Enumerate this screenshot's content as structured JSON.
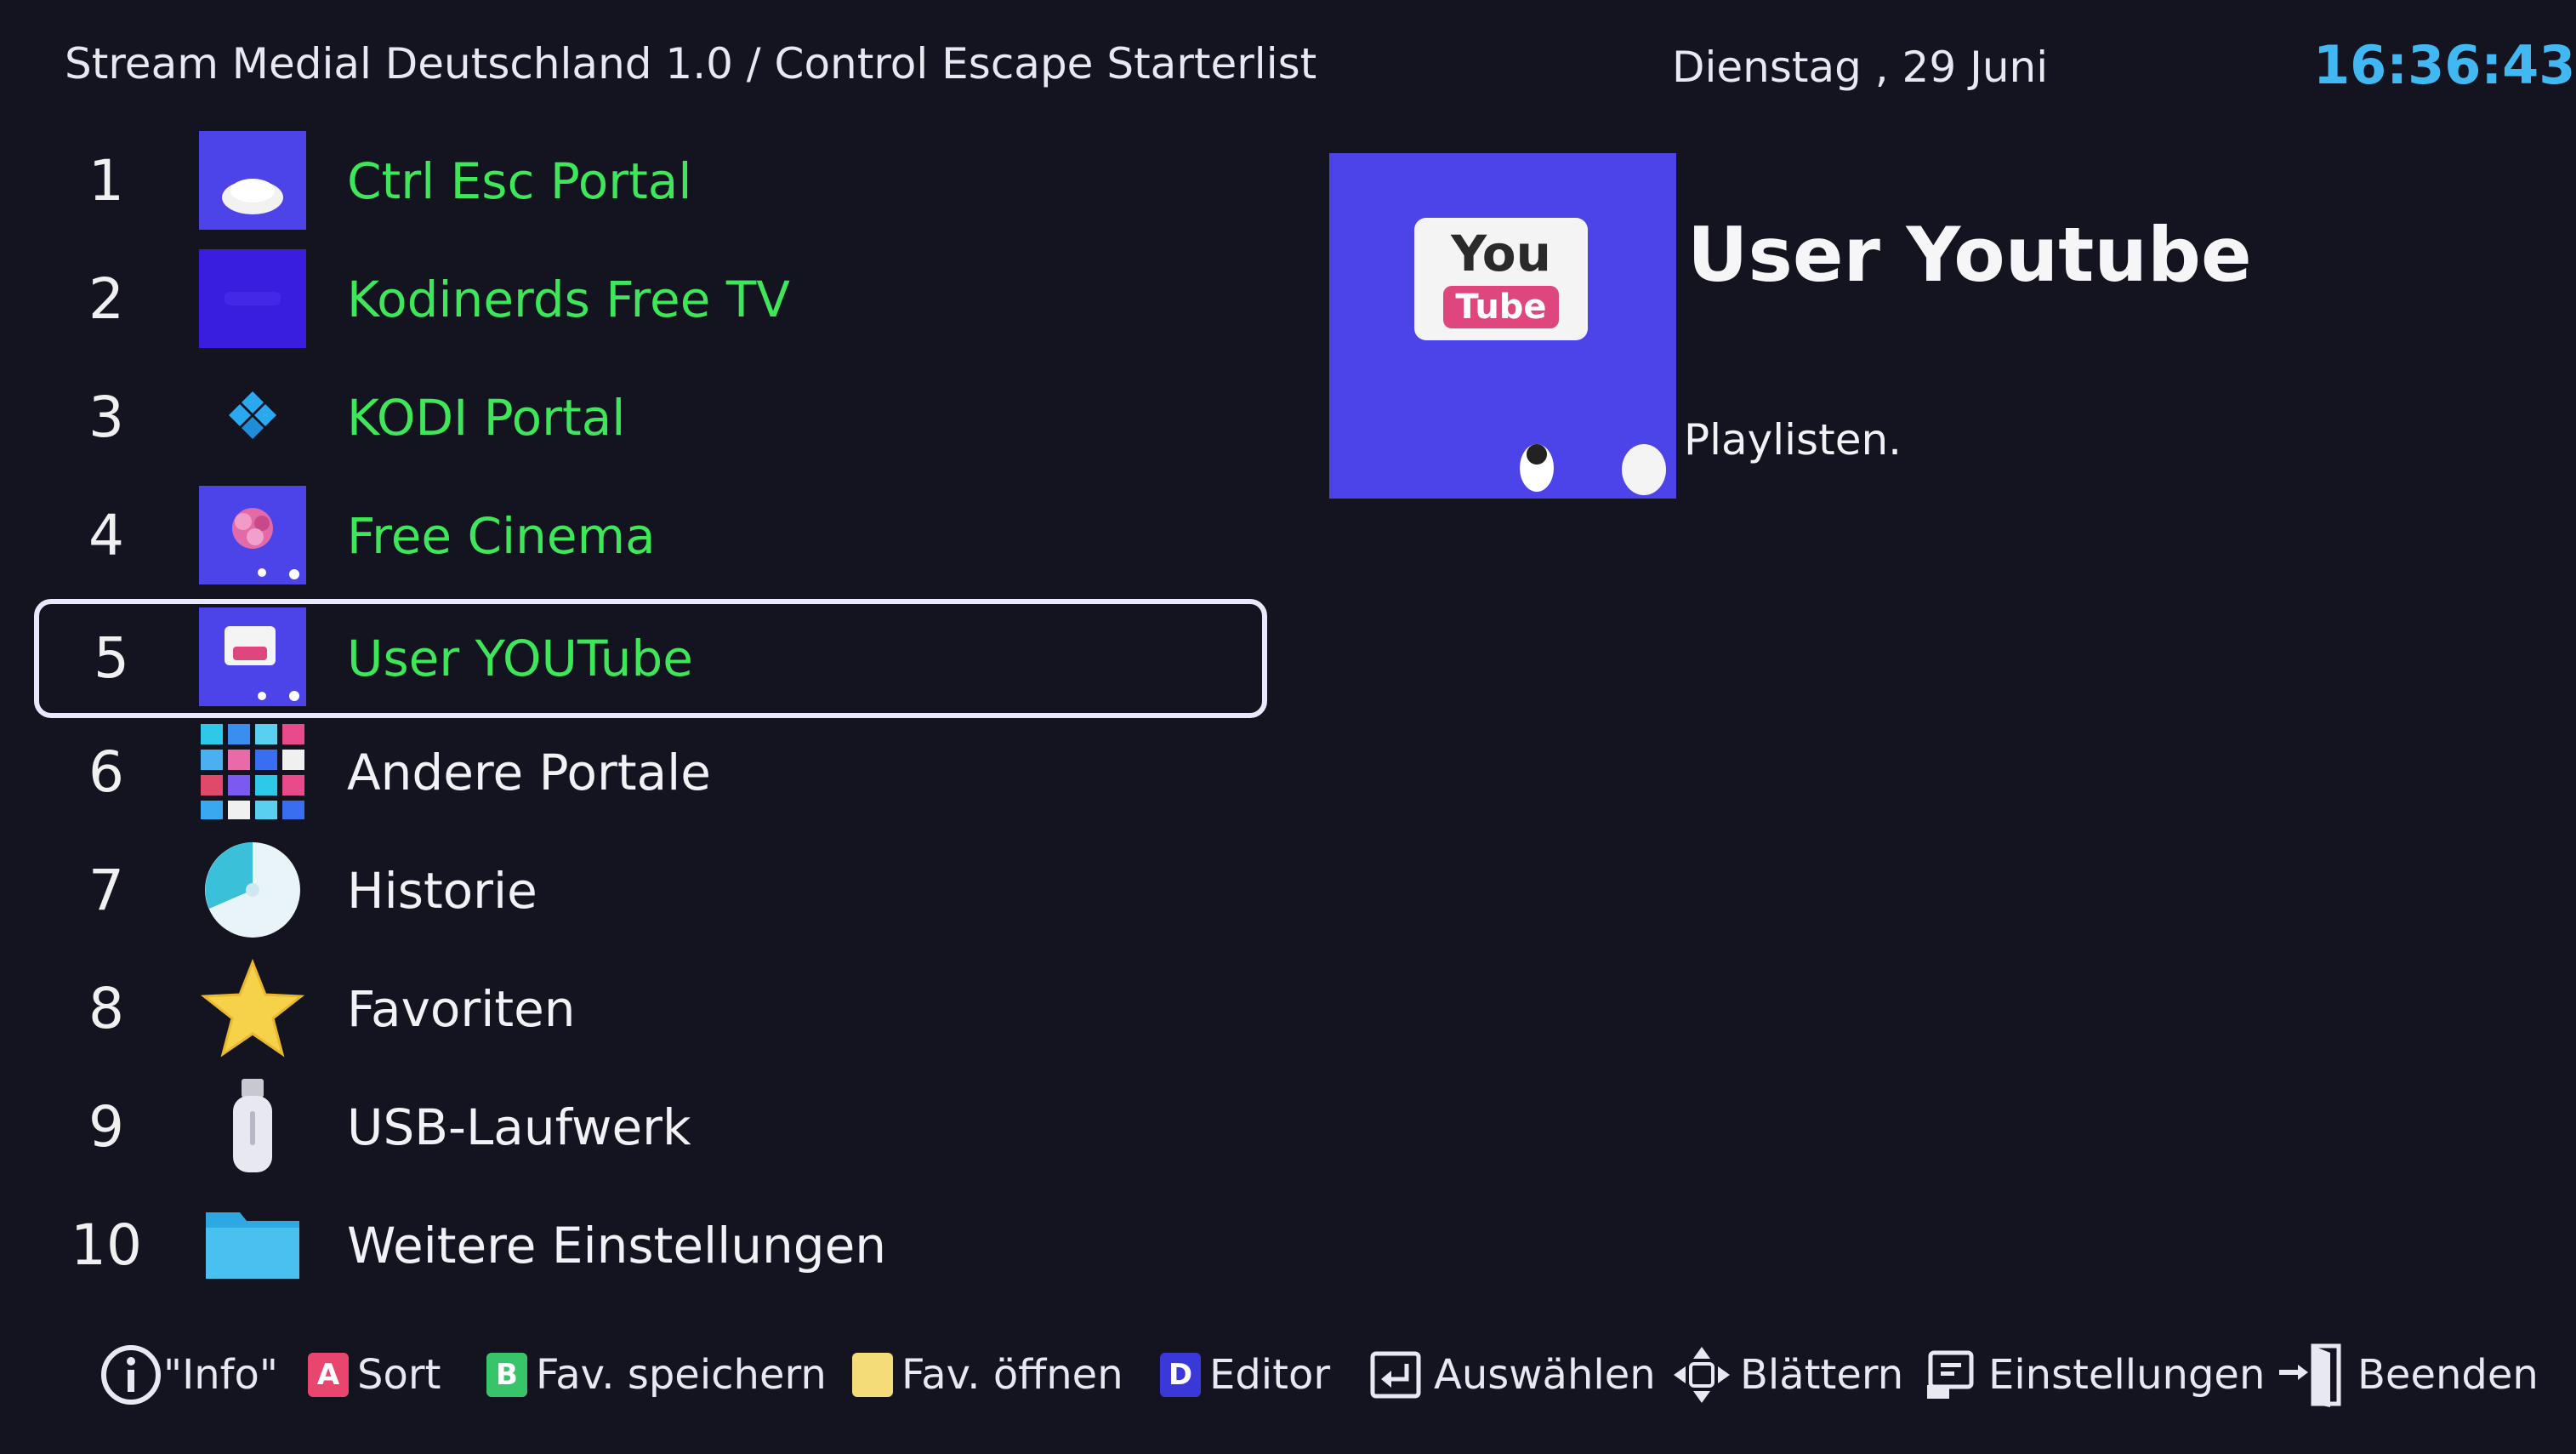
{
  "header": {
    "title": "Stream Medial Deutschland 1.0 / Control  Escape  Starterlist",
    "date": "Dienstag ,  29  Juni",
    "time": "16:36:43"
  },
  "list": [
    {
      "num": "1",
      "label": "Ctrl Esc Portal",
      "icon": "portal-logo-icon",
      "color": "green"
    },
    {
      "num": "2",
      "label": "Kodinerds Free TV",
      "icon": "kodinerds-logo-icon",
      "color": "green"
    },
    {
      "num": "3",
      "label": "KODI Portal",
      "icon": "kodi-logo-icon",
      "color": "green"
    },
    {
      "num": "4",
      "label": "Free Cinema",
      "icon": "free-cinema-logo-icon",
      "color": "green"
    },
    {
      "num": "5",
      "label": "User YOUTube",
      "icon": "youtube-logo-icon",
      "color": "green",
      "selected": true
    },
    {
      "num": "6",
      "label": "Andere Portale",
      "icon": "apps-grid-icon",
      "color": "white"
    },
    {
      "num": "7",
      "label": "Historie",
      "icon": "history-disc-icon",
      "color": "white"
    },
    {
      "num": "8",
      "label": "Favoriten",
      "icon": "star-icon",
      "color": "white"
    },
    {
      "num": "9",
      "label": "USB-Laufwerk",
      "icon": "usb-drive-icon",
      "color": "white"
    },
    {
      "num": "10",
      "label": "Weitere Einstellungen",
      "icon": "folder-icon",
      "color": "white"
    }
  ],
  "detail": {
    "title": "User Youtube",
    "description": "Playlisten.",
    "logo_you": "You",
    "logo_tube": "Tube"
  },
  "footer": {
    "info": "\"Info\"",
    "sort": "Sort",
    "key_a": "A",
    "key_b": "B",
    "key_d": "D",
    "fav_save": "Fav. speichern",
    "fav_open": "Fav. öffnen",
    "editor": "Editor",
    "select": "Auswählen",
    "browse": "Blättern",
    "settings": "Einstellungen",
    "quit": "Beenden"
  },
  "colors": {
    "background": "#141420",
    "accent_green": "#3ee65a",
    "clock_blue": "#42b8f2",
    "preview_blue": "#4c44e8",
    "key_red": "#e8466e",
    "key_green": "#38c46a",
    "key_yellow": "#f4dc78",
    "key_blue": "#3a38d8"
  }
}
